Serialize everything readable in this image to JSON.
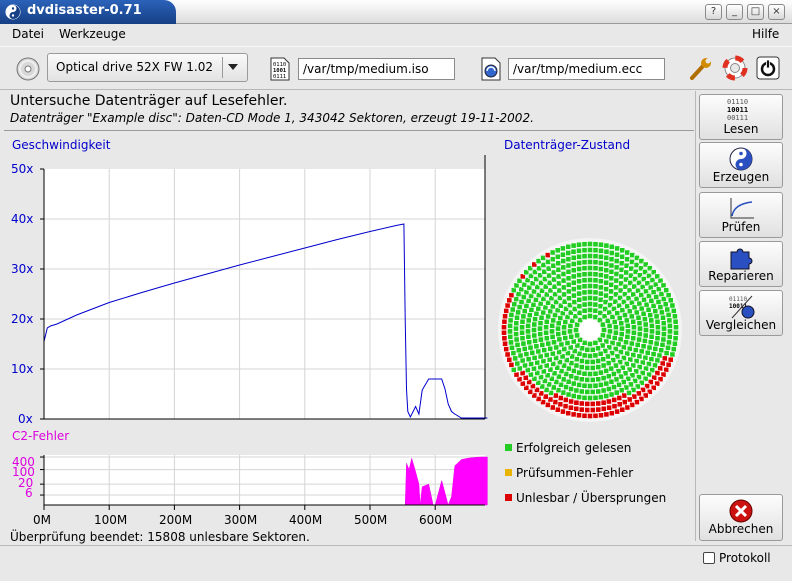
{
  "window": {
    "title": "dvdisaster-0.71"
  },
  "menu": {
    "file": "Datei",
    "tools": "Werkzeuge",
    "help": "Hilfe"
  },
  "toolbar": {
    "drive": "Optical drive 52X FW 1.02",
    "image_file": "/var/tmp/medium.iso",
    "ecc_file": "/var/tmp/medium.ecc",
    "image_icon_text": [
      "0110",
      "1001",
      "0111"
    ]
  },
  "status": {
    "line1": "Untersuche Datenträger auf Lesefehler.",
    "line2": "Datenträger \"Example disc\": Daten-CD Mode 1, 343042 Sektoren, erzeugt 19-11-2002."
  },
  "speed_chart": {
    "title": "Geschwindigkeit",
    "y_ticks": [
      "50x",
      "40x",
      "30x",
      "20x",
      "10x",
      "0x"
    ]
  },
  "c2_chart": {
    "title": "C2-Fehler",
    "y_ticks": [
      "400",
      "100",
      "20",
      "6"
    ]
  },
  "x_ticks": [
    "0M",
    "100M",
    "200M",
    "300M",
    "400M",
    "500M",
    "600M"
  ],
  "disc": {
    "title": "Datenträger-Zustand",
    "legend": {
      "ok": "Erfolgreich gelesen",
      "crc": "Prüfsummen-Fehler",
      "bad": "Unlesbar / Übersprungen"
    },
    "colors": {
      "ok": "#22cc22",
      "crc": "#e8b400",
      "bad": "#dd0000"
    }
  },
  "sidebar": {
    "read": "Lesen",
    "create": "Erzeugen",
    "verify": "Prüfen",
    "repair": "Reparieren",
    "compare": "Vergleichen",
    "abort": "Abbrechen",
    "read_icon_text": [
      "01110",
      "10011",
      "00111"
    ]
  },
  "footer": {
    "status": "Überprüfung beendet: 15808 unlesbare Sektoren.",
    "log": "Protokoll"
  },
  "chart_data": [
    {
      "type": "line",
      "title": "Geschwindigkeit",
      "xlabel": "",
      "ylabel": "",
      "x_unit": "M",
      "ylim": [
        0,
        50
      ],
      "xlim": [
        0,
        680
      ],
      "grid": true,
      "series": [
        {
          "x": [
            0,
            5,
            10,
            20,
            50,
            100,
            150,
            200,
            250,
            300,
            350,
            400,
            450,
            500,
            540,
            552,
            554,
            556,
            558,
            562,
            570,
            575,
            580,
            590,
            600,
            610,
            615,
            620,
            625,
            630,
            640,
            650,
            660,
            680
          ],
          "values": [
            15.5,
            18.2,
            18.6,
            19.0,
            20.8,
            23.3,
            25.3,
            27.2,
            29.0,
            30.8,
            32.5,
            34.2,
            35.9,
            37.5,
            38.7,
            39.0,
            20.0,
            6.0,
            1.5,
            0.4,
            2.5,
            1.0,
            5.8,
            8.0,
            8.0,
            8.0,
            6.0,
            3.0,
            1.5,
            1.0,
            0.2,
            0.2,
            0.2,
            0.2
          ]
        }
      ]
    },
    {
      "type": "area",
      "title": "C2-Fehler",
      "x_unit": "M",
      "xlim": [
        0,
        680
      ],
      "y_scale": "log",
      "y_ticks": [
        6,
        20,
        100,
        400
      ],
      "series": [
        {
          "x": [
            552,
            554,
            556,
            560,
            564,
            570,
            575,
            577,
            580,
            590,
            597,
            600,
            610,
            620,
            625,
            630,
            640,
            650,
            660,
            670,
            680
          ],
          "values": [
            0,
            2,
            200,
            100,
            350,
            80,
            20,
            0,
            15,
            20,
            0,
            0,
            30,
            0,
            5,
            150,
            300,
            350,
            380,
            400,
            400
          ]
        }
      ]
    }
  ]
}
